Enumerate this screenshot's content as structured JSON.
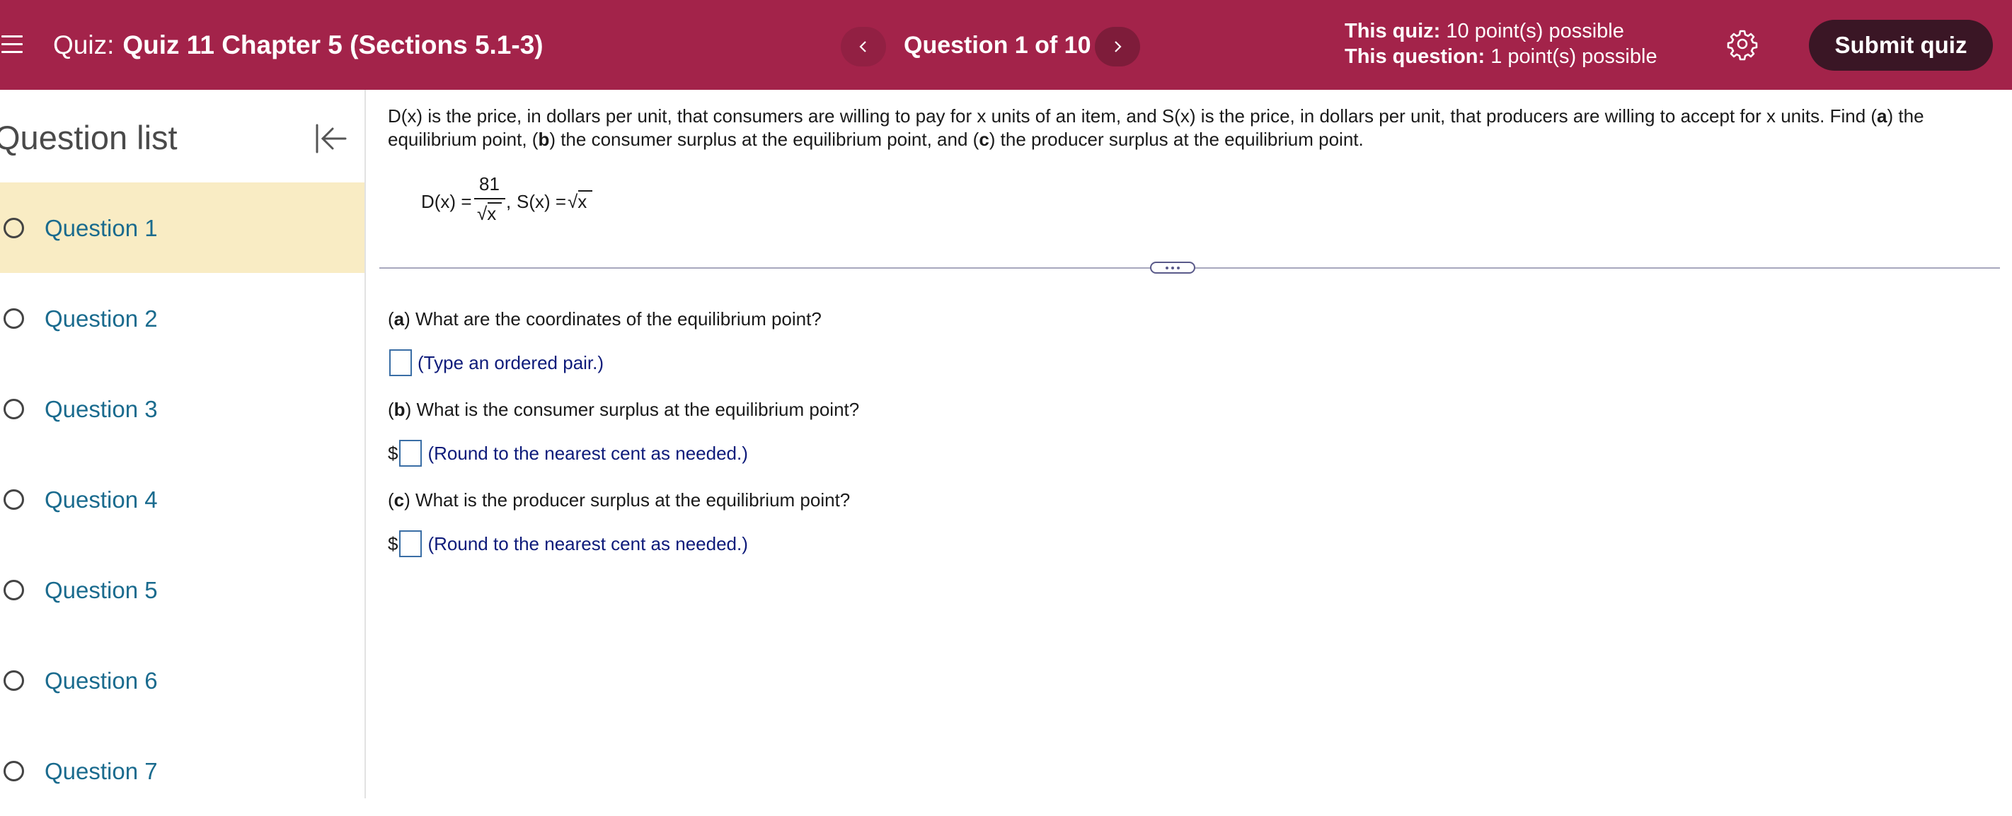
{
  "header": {
    "quiz_prefix": "Quiz:",
    "quiz_name": "Quiz 11 Chapter 5 (Sections 5.1-3)",
    "question_counter": "Question 1 of 10",
    "this_quiz_label": "This quiz:",
    "this_quiz_value": "10 point(s) possible",
    "this_question_label": "This question:",
    "this_question_value": "1 point(s) possible",
    "submit_label": "Submit quiz",
    "icons": {
      "menu": "hamburger-menu-icon",
      "prev": "chevron-left-icon",
      "next": "chevron-right-icon",
      "settings": "gear-icon"
    },
    "colors": {
      "bar": "#a3234a",
      "submit": "#3a1625"
    }
  },
  "sidebar": {
    "title": "Question list",
    "collapse_icon": "collapse-left-icon",
    "items": [
      {
        "label": "Question 1",
        "active": true
      },
      {
        "label": "Question 2",
        "active": false
      },
      {
        "label": "Question 3",
        "active": false
      },
      {
        "label": "Question 4",
        "active": false
      },
      {
        "label": "Question 5",
        "active": false
      },
      {
        "label": "Question 6",
        "active": false
      },
      {
        "label": "Question 7",
        "active": false
      }
    ]
  },
  "question": {
    "prompt": {
      "t1": "D(x) is the price, in dollars per unit, that consumers are willing to pay for x units of an item, and S(x) is the price, in dollars per unit, that producers are willing to accept for x units. Find (",
      "a": "a",
      "t2": ") the equilibrium point, (",
      "b": "b",
      "t3": ") the consumer surplus at the equilibrium point, and (",
      "c": "c",
      "t4": ") the producer surplus at the equilibrium point."
    },
    "formula": {
      "d_lhs": "D(x) =",
      "numerator": "81",
      "denominator": "√x",
      "comma": ",",
      "s_lhs": "S(x) =",
      "s_rhs": "√x"
    },
    "parts": [
      {
        "letter": "a",
        "text": " What are the coordinates of the equilibrium point?",
        "prefix": "",
        "hint": "(Type an ordered pair.)"
      },
      {
        "letter": "b",
        "text": " What is the consumer surplus at the equilibrium point?",
        "prefix": "$",
        "hint": "(Round to the nearest cent as needed.)"
      },
      {
        "letter": "c",
        "text": " What is the producer surplus at the equilibrium point?",
        "prefix": "$",
        "hint": "(Round to the nearest cent as needed.)"
      }
    ]
  }
}
